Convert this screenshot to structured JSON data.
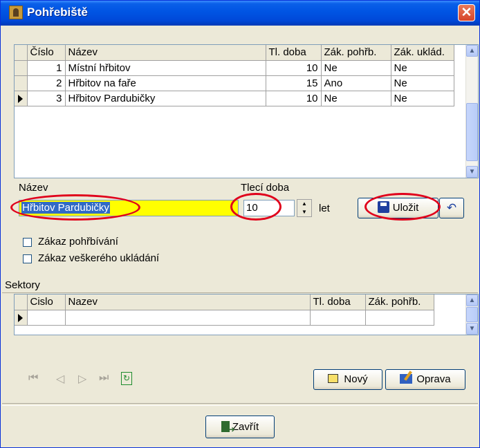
{
  "window": {
    "title": "Pohřebiště",
    "close_label": "✕"
  },
  "main_grid": {
    "headers": [
      "Číslo",
      "Název",
      "Tl. doba",
      "Zák. pohřb.",
      "Zák. uklád."
    ],
    "rows": [
      {
        "cislo": "1",
        "nazev": "Místní hřbitov",
        "tl_doba": "10",
        "zak_pohrb": "Ne",
        "zak_uklad": "Ne"
      },
      {
        "cislo": "2",
        "nazev": "Hřbitov na faře",
        "tl_doba": "15",
        "zak_pohrb": "Ano",
        "zak_uklad": "Ne"
      },
      {
        "cislo": "3",
        "nazev": "Hřbitov Pardubičky",
        "tl_doba": "10",
        "zak_pohrb": "Ne",
        "zak_uklad": "Ne"
      }
    ],
    "current_row": 3
  },
  "form": {
    "nazev_label": "Název",
    "nazev_value": "Hřbitov Pardubičky",
    "tleci_label": "Tlecí doba",
    "tleci_value": "10",
    "tleci_unit": "let",
    "save_label": "Uložit",
    "undo_icon": "undo-icon",
    "checkbox_1": {
      "label": "Zákaz pohřbívání",
      "checked": false
    },
    "checkbox_2": {
      "label": "Zákaz veškerého ukládání",
      "checked": false
    }
  },
  "sectors": {
    "section_label": "Sektory",
    "headers": [
      "Cislo",
      "Nazev",
      "Tl. doba",
      "Zák. pohřb."
    ]
  },
  "nav": {
    "icons": [
      "first-record-icon",
      "prev-record-icon",
      "next-record-icon",
      "last-record-icon",
      "refresh-icon"
    ]
  },
  "buttons": {
    "new_label": "Nový",
    "edit_label": "Oprava",
    "close_label": "Zavřít"
  },
  "colors": {
    "title_blue": "#0054e3",
    "highlight_yellow": "#ffff00",
    "selection_blue": "#316ac5",
    "annotation_red": "#e0001b"
  }
}
